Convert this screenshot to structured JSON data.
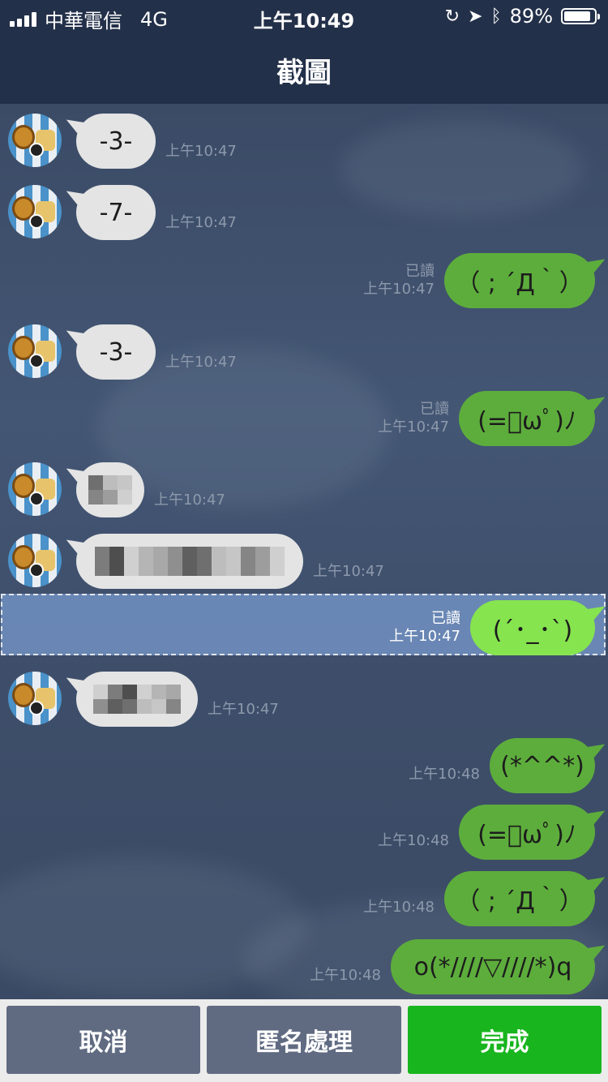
{
  "status_bar": {
    "carrier": "中華電信",
    "network": "4G",
    "time": "上午10:49",
    "battery_percent": "89%",
    "battery_level": 0.89,
    "icons": [
      "signal-icon",
      "rotation-lock-icon",
      "location-icon",
      "bluetooth-icon",
      "battery-icon"
    ]
  },
  "nav": {
    "title": "截圖"
  },
  "messages": [
    {
      "side": "in",
      "text": "-3-",
      "time": "上午10:47"
    },
    {
      "side": "in",
      "text": "-7-",
      "time": "上午10:47"
    },
    {
      "side": "out",
      "text": "（ ; ´Д｀）",
      "time": "上午10:47",
      "read": "已讀"
    },
    {
      "side": "in",
      "text": "-3-",
      "time": "上午10:47"
    },
    {
      "side": "out",
      "text": "(=ﾟωﾟ)ﾉ",
      "time": "上午10:47",
      "read": "已讀"
    },
    {
      "side": "in",
      "text": "",
      "pixelated": true,
      "time": "上午10:47"
    },
    {
      "side": "in",
      "text": "",
      "pixelated": true,
      "time": "上午10:47"
    },
    {
      "side": "out",
      "text": "(´･_･`)",
      "time": "上午10:47",
      "read": "已讀",
      "selected": true
    },
    {
      "side": "in",
      "text": "",
      "pixelated": true,
      "time": "上午10:47"
    },
    {
      "side": "out",
      "text": "(*^^*)",
      "time": "上午10:48"
    },
    {
      "side": "out",
      "text": "(=ﾟωﾟ)ﾉ",
      "time": "上午10:48"
    },
    {
      "side": "out",
      "text": "（ ; ´Д｀）",
      "time": "上午10:48"
    },
    {
      "side": "out",
      "text": "o(*////▽////*)q",
      "time": "上午10:48"
    }
  ],
  "toolbar": {
    "cancel_label": "取消",
    "anonymize_label": "匿名處理",
    "done_label": "完成"
  },
  "colors": {
    "header": "#233049",
    "incoming_bubble": "#e4e4e4",
    "outgoing_bubble": "#5dad3c",
    "selected_bubble": "#86e44f",
    "done_button": "#18b51e",
    "toolbar_button": "#606b82"
  }
}
